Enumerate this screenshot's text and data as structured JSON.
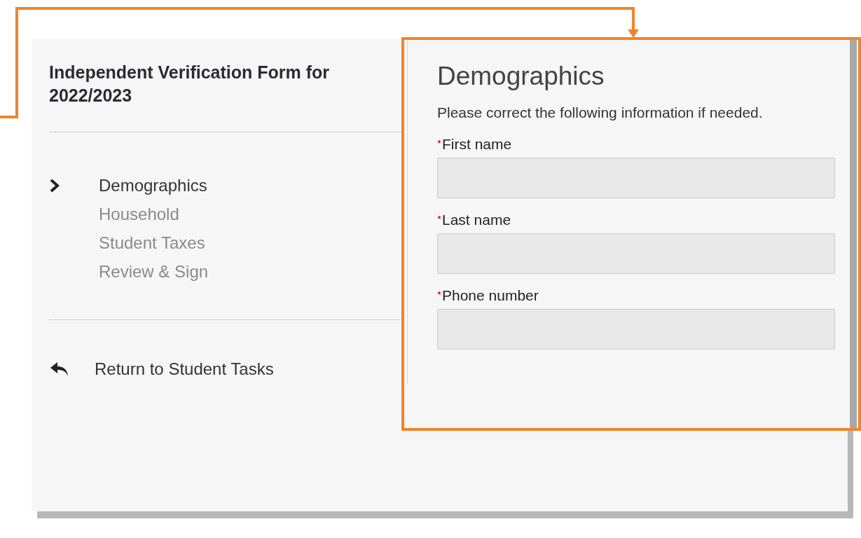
{
  "form": {
    "title": "Independent Verification Form for 2022/2023"
  },
  "steps": [
    {
      "label": "Demographics",
      "selected": true
    },
    {
      "label": "Household",
      "selected": false
    },
    {
      "label": "Student Taxes",
      "selected": false
    },
    {
      "label": "Review & Sign",
      "selected": false
    }
  ],
  "return_link": {
    "label": "Return to Student Tasks"
  },
  "panel": {
    "title": "Demographics",
    "instructions": "Please correct the following information if needed.",
    "fields": [
      {
        "label": "First name",
        "required": true
      },
      {
        "label": "Last name",
        "required": true
      },
      {
        "label": "Phone number",
        "required": true
      }
    ]
  }
}
